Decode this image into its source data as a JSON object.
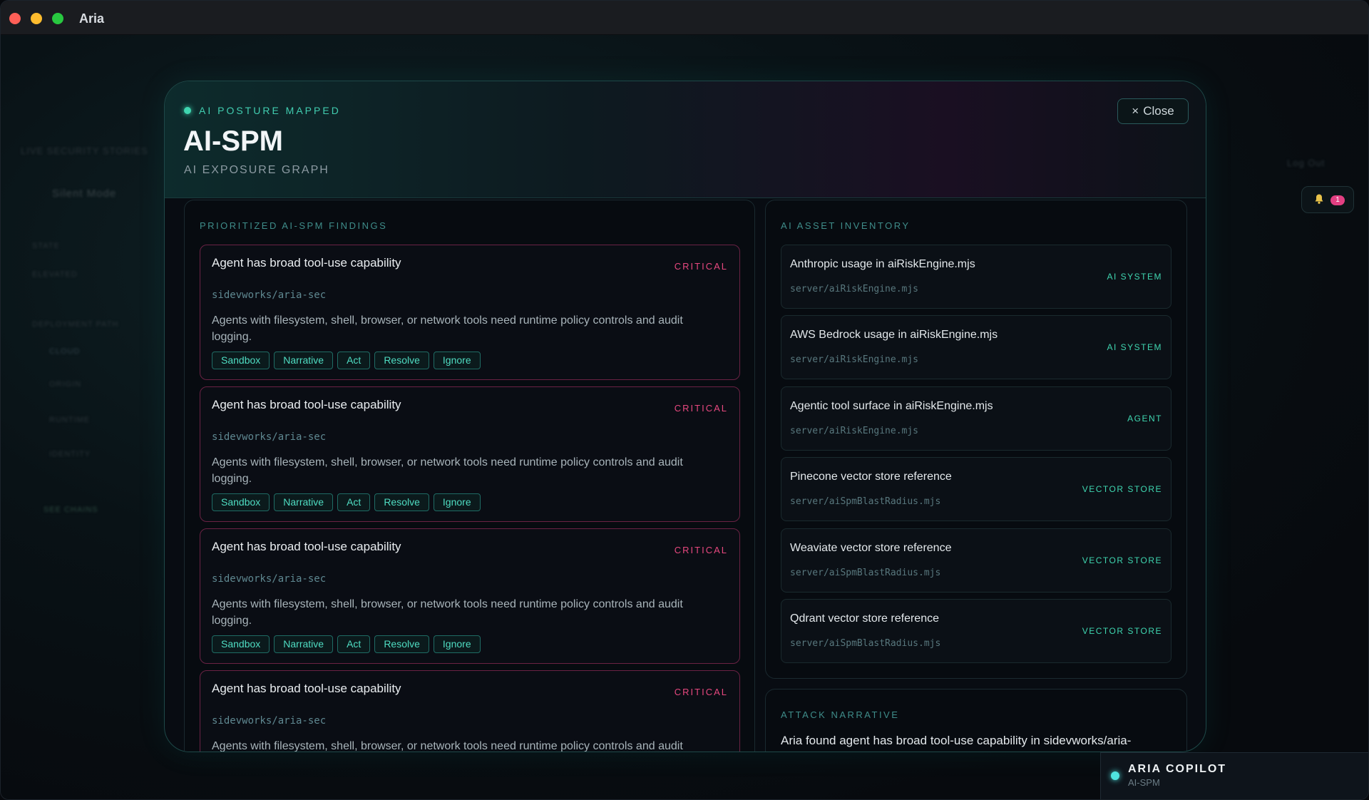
{
  "window": {
    "title": "Aria"
  },
  "backdrop": {
    "texts": [
      "LIVE SECURITY STORIES",
      "Silent Mode",
      "STATE",
      "ELEVATED",
      "DEPLOYMENT PATH",
      "CLOUD",
      "ORIGIN",
      "RUNTIME",
      "IDENTITY",
      "RUNTIME",
      "SEE CHAINS",
      "Log Out"
    ]
  },
  "notifications": {
    "count": "1",
    "icon": "bell-icon"
  },
  "modal": {
    "status": "AI POSTURE MAPPED",
    "title": "AI-SPM",
    "subtitle": "AI EXPOSURE GRAPH",
    "close_label": "Close",
    "findings": {
      "label": "PRIORITIZED AI-SPM FINDINGS",
      "items": [
        {
          "title": "Agent has broad tool-use capability",
          "severity": "CRITICAL",
          "repo": "sidevworks/aria-sec",
          "description": "Agents with filesystem, shell, browser, or network tools need runtime policy controls and audit logging."
        },
        {
          "title": "Agent has broad tool-use capability",
          "severity": "CRITICAL",
          "repo": "sidevworks/aria-sec",
          "description": "Agents with filesystem, shell, browser, or network tools need runtime policy controls and audit logging."
        },
        {
          "title": "Agent has broad tool-use capability",
          "severity": "CRITICAL",
          "repo": "sidevworks/aria-sec",
          "description": "Agents with filesystem, shell, browser, or network tools need runtime policy controls and audit logging."
        },
        {
          "title": "Agent has broad tool-use capability",
          "severity": "CRITICAL",
          "repo": "sidevworks/aria-sec",
          "description": "Agents with filesystem, shell, browser, or network tools need runtime policy controls and audit"
        }
      ],
      "actions": [
        "Sandbox",
        "Narrative",
        "Act",
        "Resolve",
        "Ignore"
      ]
    },
    "inventory": {
      "label": "AI ASSET INVENTORY",
      "items": [
        {
          "name": "Anthropic usage in aiRiskEngine.mjs",
          "path": "server/aiRiskEngine.mjs",
          "type": "AI SYSTEM"
        },
        {
          "name": "AWS Bedrock usage in aiRiskEngine.mjs",
          "path": "server/aiRiskEngine.mjs",
          "type": "AI SYSTEM"
        },
        {
          "name": "Agentic tool surface in aiRiskEngine.mjs",
          "path": "server/aiRiskEngine.mjs",
          "type": "AGENT"
        },
        {
          "name": "Pinecone vector store reference",
          "path": "server/aiSpmBlastRadius.mjs",
          "type": "VECTOR STORE"
        },
        {
          "name": "Weaviate vector store reference",
          "path": "server/aiSpmBlastRadius.mjs",
          "type": "VECTOR STORE"
        },
        {
          "name": "Qdrant vector store reference",
          "path": "server/aiSpmBlastRadius.mjs",
          "type": "VECTOR STORE"
        }
      ]
    },
    "narrative": {
      "label": "ATTACK NARRATIVE",
      "text": "Aria found agent has broad tool-use capability in sidevworks/aria-"
    }
  },
  "copilot": {
    "title": "ARIA COPILOT",
    "subtitle": "AI-SPM"
  }
}
